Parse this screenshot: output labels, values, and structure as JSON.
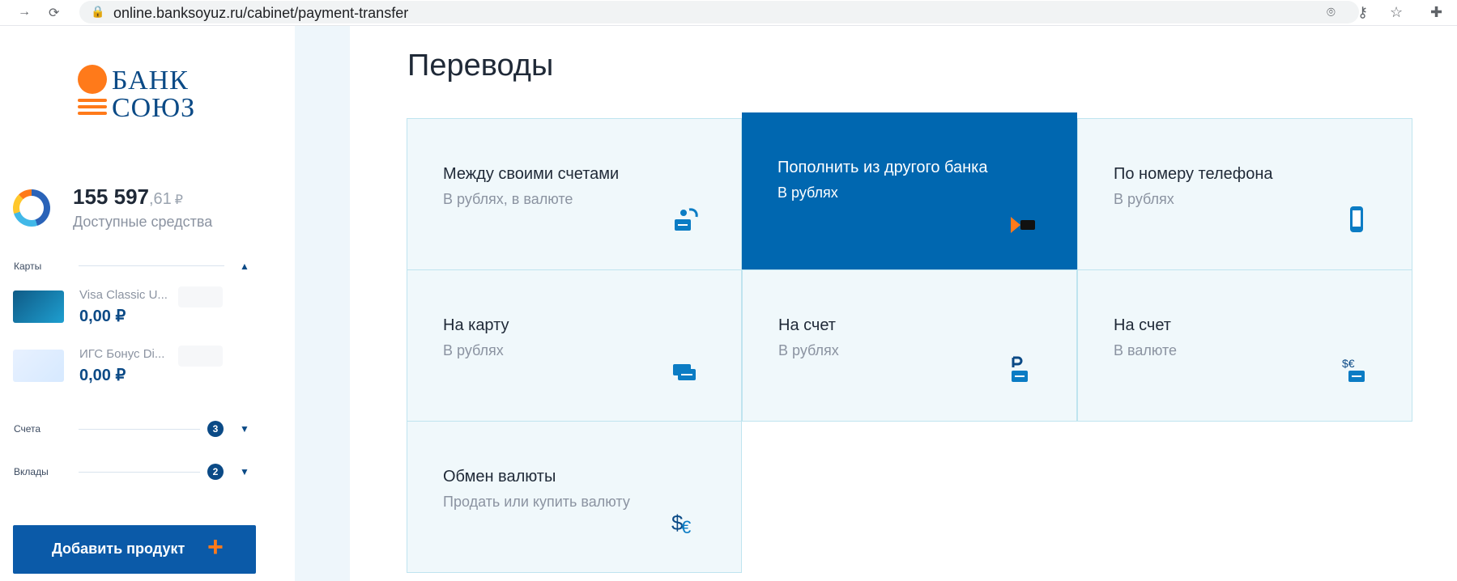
{
  "browser": {
    "url": "online.banksoyuz.ru/cabinet/payment-transfer"
  },
  "sidebar": {
    "logo": {
      "line1": "БАНК",
      "line2": "СОЮЗ"
    },
    "balance": {
      "integer": "155 597",
      "cents": ",61",
      "currency": "₽",
      "caption": "Доступные средства"
    },
    "sections": {
      "cards_label": "Карты",
      "accounts_label": "Счета",
      "deposits_label": "Вклады",
      "accounts_count": "3",
      "deposits_count": "2"
    },
    "cards": [
      {
        "name": "Visa Classic U...",
        "balance": "0,00 ₽"
      },
      {
        "name": "ИГС Бонус Di...",
        "balance": "0,00 ₽"
      }
    ],
    "add_button_label": "Добавить продукт"
  },
  "main": {
    "title": "Переводы",
    "tiles": [
      {
        "title": "Между своими счетами",
        "subtitle": "В рублях, в валюте",
        "icon": "transfer-own-icon"
      },
      {
        "title": "Пополнить из другого банка",
        "subtitle": "В рублях",
        "icon": "sbp-icon",
        "active": true
      },
      {
        "title": "По номеру телефона",
        "subtitle": "В рублях",
        "icon": "phone-icon"
      },
      {
        "title": "На карту",
        "subtitle": "В рублях",
        "icon": "card-transfer-icon"
      },
      {
        "title": "На счет",
        "subtitle": "В рублях",
        "icon": "ruble-transfer-icon"
      },
      {
        "title": "На счет",
        "subtitle": "В валюте",
        "icon": "currency-transfer-icon"
      },
      {
        "title": "Обмен валюты",
        "subtitle": "Продать или купить валюту",
        "icon": "exchange-icon"
      }
    ]
  },
  "colors": {
    "brand_blue": "#0067b0",
    "accent_orange": "#ff7a1a"
  }
}
